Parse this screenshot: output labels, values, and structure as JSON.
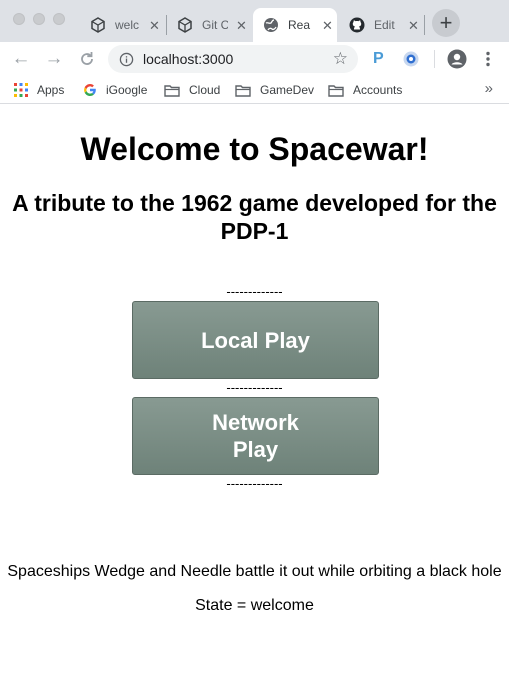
{
  "browser": {
    "tabs": [
      {
        "title": "welc",
        "icon": "codesandbox-icon",
        "active": false
      },
      {
        "title": "Git C",
        "icon": "codesandbox-icon",
        "active": false
      },
      {
        "title": "Rea",
        "icon": "globe-icon",
        "active": true
      },
      {
        "title": "Edit",
        "icon": "github-icon",
        "active": false
      }
    ],
    "close_glyph": "✕",
    "new_tab_glyph": "+",
    "url": "localhost:3000",
    "bookmarks": [
      {
        "label": "Apps",
        "icon": "apps-grid-icon"
      },
      {
        "label": "iGoogle",
        "icon": "google-icon"
      },
      {
        "label": "Cloud",
        "icon": "folder-icon"
      },
      {
        "label": "GameDev",
        "icon": "folder-icon"
      },
      {
        "label": "Accounts",
        "icon": "folder-icon"
      }
    ],
    "bookmarks_more": "»",
    "extension_p": "P"
  },
  "page": {
    "title": "Welcome to Spacewar!",
    "subtitle": "A tribute to the 1962 game developed for the PDP-1",
    "divider": "-------------",
    "local_play_label": "Local Play",
    "network_play_label": "Network Play",
    "tagline": "Spaceships Wedge and Needle battle it out while orbiting a black hole",
    "state_text": "State = welcome"
  },
  "colors": {
    "button_fill": "#7b8e86",
    "tabbar": "#dee1e6"
  }
}
